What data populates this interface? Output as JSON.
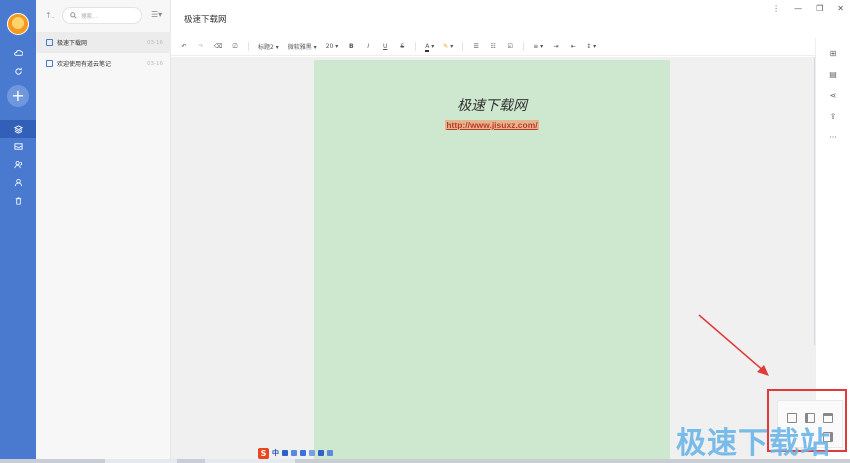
{
  "window": {
    "title": "极速下载网",
    "controls": [
      "⋮",
      "—",
      "❐",
      "✕"
    ]
  },
  "sidebar": {
    "icons": [
      "cloud-sync-icon",
      "refresh-icon",
      "notes-stack-icon",
      "inbox-icon",
      "collab-icon",
      "share-user-icon",
      "trash-icon"
    ],
    "add_label": "+"
  },
  "note_list": {
    "back_label": "↑.",
    "search_placeholder": "搜索...",
    "sort_label": "☰▾",
    "items": [
      {
        "title": "极速下载网",
        "date": "03-16"
      },
      {
        "title": "欢迎使用有道云笔记",
        "date": "03-16"
      }
    ]
  },
  "toolbar": {
    "undo": "↶",
    "redo": "↷",
    "eraser": "⌫",
    "format_painter": "⎚",
    "heading": "标题2",
    "font": "微软雅黑",
    "size": "20",
    "bold": "B",
    "italic": "I",
    "underline": "U",
    "strike": "S",
    "font_color": "A",
    "highlight": "✎",
    "bullet_list": "☰",
    "numbered_list": "☷",
    "checklist": "☑",
    "align": "≡",
    "indent_in": "⇥",
    "indent_out": "⇤",
    "line_height": "↕"
  },
  "document": {
    "heading": "极速下载网",
    "link": "http://www.jisuxz.com/"
  },
  "right_bar": {
    "icons": [
      "insert-icon",
      "document-icon",
      "share-icon",
      "export-icon",
      "more-icon"
    ],
    "labels": [
      "⊞",
      "▤",
      "⋖",
      "⇪",
      "···"
    ]
  },
  "layout_popup": {
    "options": [
      "single-pane",
      "two-pane",
      "three-pane",
      "list-pane"
    ]
  },
  "ime": {
    "logo": "S",
    "mode": "中"
  },
  "watermark": "极速下载站",
  "colors": {
    "rail": "#4a7ad0",
    "page_bg": "#cde8cf",
    "highlight_box": "#e03a3a",
    "link": "#c0392b"
  }
}
